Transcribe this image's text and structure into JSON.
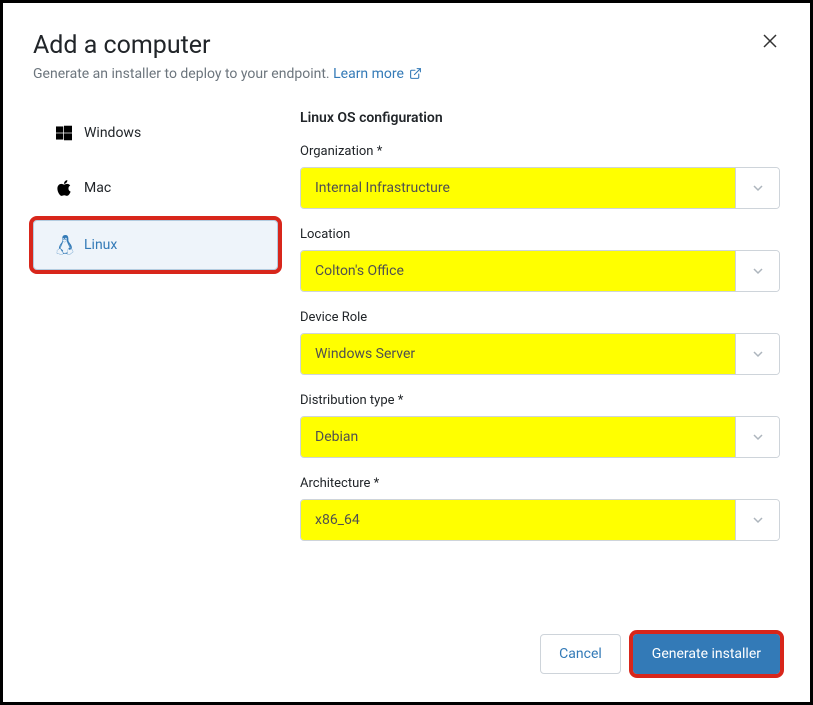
{
  "dialog": {
    "title": "Add a computer",
    "subtitle": "Generate an installer to deploy to your endpoint.",
    "learn_more": "Learn more"
  },
  "sidebar": {
    "tabs": [
      {
        "label": "Windows",
        "icon": "windows-icon"
      },
      {
        "label": "Mac",
        "icon": "apple-icon"
      },
      {
        "label": "Linux",
        "icon": "linux-icon"
      }
    ]
  },
  "form": {
    "section_title": "Linux OS configuration",
    "fields": [
      {
        "label": "Organization *",
        "value": "Internal Infrastructure"
      },
      {
        "label": "Location",
        "value": "Colton's Office"
      },
      {
        "label": "Device Role",
        "value": "Windows Server"
      },
      {
        "label": "Distribution type *",
        "value": "Debian"
      },
      {
        "label": "Architecture *",
        "value": "x86_64"
      }
    ]
  },
  "footer": {
    "cancel": "Cancel",
    "generate": "Generate installer"
  }
}
